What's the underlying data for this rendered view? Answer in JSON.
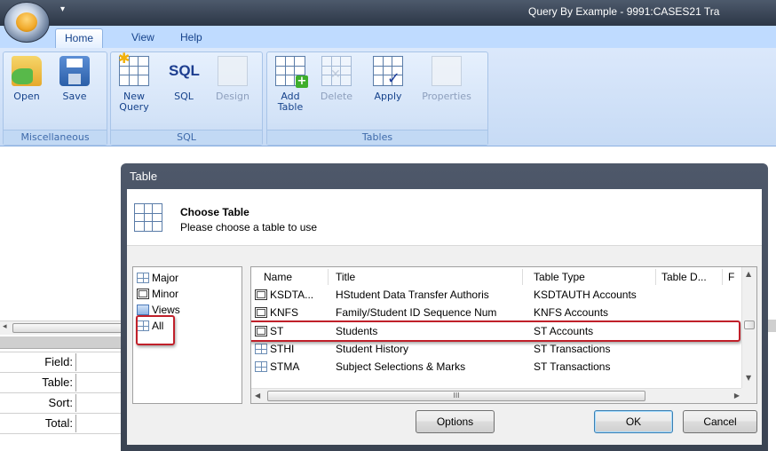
{
  "window": {
    "title": "Query By Example - 9991:CASES21 Tra"
  },
  "tabs": [
    {
      "label": "Home",
      "active": true
    },
    {
      "label": "View",
      "active": false
    },
    {
      "label": "Help",
      "active": false
    }
  ],
  "ribbon": {
    "groups": [
      {
        "label": "Miscellaneous"
      },
      {
        "label": "SQL"
      },
      {
        "label": "Tables"
      }
    ],
    "buttons": {
      "open": "Open",
      "save": "Save",
      "new_query_1": "New",
      "new_query_2": "Query",
      "sql": "SQL",
      "sql_icon_text": "SQL",
      "design": "Design",
      "add_table_1": "Add",
      "add_table_2": "Table",
      "delete": "Delete",
      "apply": "Apply",
      "properties": "Properties"
    }
  },
  "grid_rows": [
    "Field:",
    "Table:",
    "Sort:",
    "Total:"
  ],
  "dialog": {
    "title": "Table",
    "header_title": "Choose Table",
    "header_subtitle": "Please choose a table to use",
    "categories": [
      {
        "label": "Major",
        "icon": "table-icon"
      },
      {
        "label": "Minor",
        "icon": "table-icon"
      },
      {
        "label": "Views",
        "icon": "views-icon"
      },
      {
        "label": "All",
        "icon": "table-icon",
        "highlighted": true
      }
    ],
    "columns": [
      "Name",
      "Title",
      "Table Type",
      "Table D...",
      "F"
    ],
    "rows": [
      {
        "name": "KSDTA...",
        "title": "HStudent Data Transfer Authoris",
        "type": "KSDTAUTH Accounts"
      },
      {
        "name": "KNFS",
        "title": "Family/Student ID Sequence Num",
        "type": "KNFS Accounts"
      },
      {
        "name": "ST",
        "title": "Students",
        "type": "ST Accounts",
        "highlighted": true
      },
      {
        "name": "STHI",
        "title": "Student History",
        "type": "ST Transactions"
      },
      {
        "name": "STMA",
        "title": "Subject Selections & Marks",
        "type": "ST Transactions"
      }
    ],
    "hscroll_grip": "III",
    "buttons": {
      "options": "Options",
      "ok": "OK",
      "cancel": "Cancel"
    }
  },
  "colors": {
    "highlight_box": "#c0202a",
    "ribbon": "#dbe8fb",
    "title_bar": "#3a4352"
  }
}
